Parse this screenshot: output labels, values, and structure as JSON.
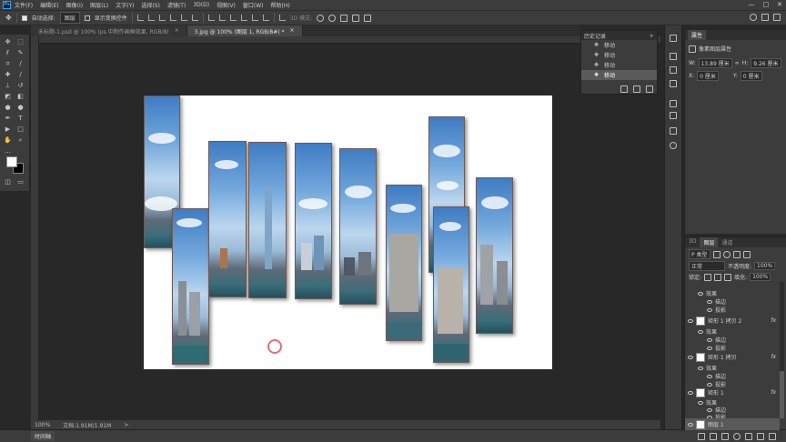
{
  "menubar": {
    "logo": "Ps",
    "items": [
      "文件(F)",
      "编辑(E)",
      "图像(I)",
      "图层(L)",
      "文字(Y)",
      "选择(S)",
      "滤镜(T)",
      "3D(D)",
      "视图(V)",
      "窗口(W)",
      "帮助(H)"
    ],
    "controls": [
      "—",
      "□",
      "✕"
    ]
  },
  "optbar": {
    "auto_select_label": "自动选择:",
    "auto_select_value": "图层",
    "transform_label": "显示变换控件",
    "mode_3d_label": "3D 模式:"
  },
  "tabs": [
    {
      "label": "未标题-1.psd @ 100% (ps 中制作画框效果, RGB/8)",
      "close": "×",
      "active": false
    },
    {
      "label": "3.jpg @ 100% (图层 1, RGB/8#) *",
      "close": "×",
      "active": true
    }
  ],
  "status": {
    "zoom": "100%",
    "doc": "文档:1.91M/1.91M",
    "arrow": ">",
    "timeline": "时间轴"
  },
  "history": {
    "title": "历史记录",
    "collapse": "»",
    "menu": "≡",
    "items": [
      {
        "label": "移动",
        "selected": false
      },
      {
        "label": "移动",
        "selected": false
      },
      {
        "label": "移动",
        "selected": false
      },
      {
        "label": "移动",
        "selected": true
      }
    ]
  },
  "properties": {
    "tab": "属性",
    "header": "像素图层属性",
    "w_label": "W:",
    "w_value": "13.89 厘米",
    "link": "∞",
    "h_label": "H:",
    "h_value": "9.26 厘米",
    "x_label": "X:",
    "x_value": "0 厘米",
    "y_label": "Y:",
    "y_value": "0 厘米"
  },
  "layers": {
    "tabs": [
      "3D",
      "图层",
      "通道"
    ],
    "active_tab": 1,
    "filter_kind": "P 类型",
    "blend_mode": "正常",
    "opacity_label": "不透明度:",
    "opacity_value": "100%",
    "lock_label": "锁定:",
    "fill_label": "填充:",
    "fill_value": "100%",
    "rows": [
      {
        "kind": "effect",
        "label": "效果"
      },
      {
        "kind": "sub",
        "label": "描边"
      },
      {
        "kind": "sub",
        "label": "投影"
      },
      {
        "kind": "layer",
        "label": "矩形 1 拷贝 2",
        "fx": "fx"
      },
      {
        "kind": "effect",
        "label": "效果"
      },
      {
        "kind": "sub",
        "label": "描边"
      },
      {
        "kind": "sub",
        "label": "投影"
      },
      {
        "kind": "layer",
        "label": "矩形 1 拷贝",
        "fx": "fx"
      },
      {
        "kind": "effect",
        "label": "效果"
      },
      {
        "kind": "sub",
        "label": "描边"
      },
      {
        "kind": "sub",
        "label": "投影"
      },
      {
        "kind": "layer",
        "label": "矩形 1",
        "fx": "fx"
      },
      {
        "kind": "effect",
        "label": "效果"
      },
      {
        "kind": "sub",
        "label": "描边"
      },
      {
        "kind": "sub",
        "label": "投影"
      },
      {
        "kind": "layer",
        "label": "图层 1",
        "fx": ""
      }
    ]
  },
  "colors": {
    "accent": "#2fa3f7",
    "panel": "#3c3c3c",
    "workspace": "#282828"
  }
}
